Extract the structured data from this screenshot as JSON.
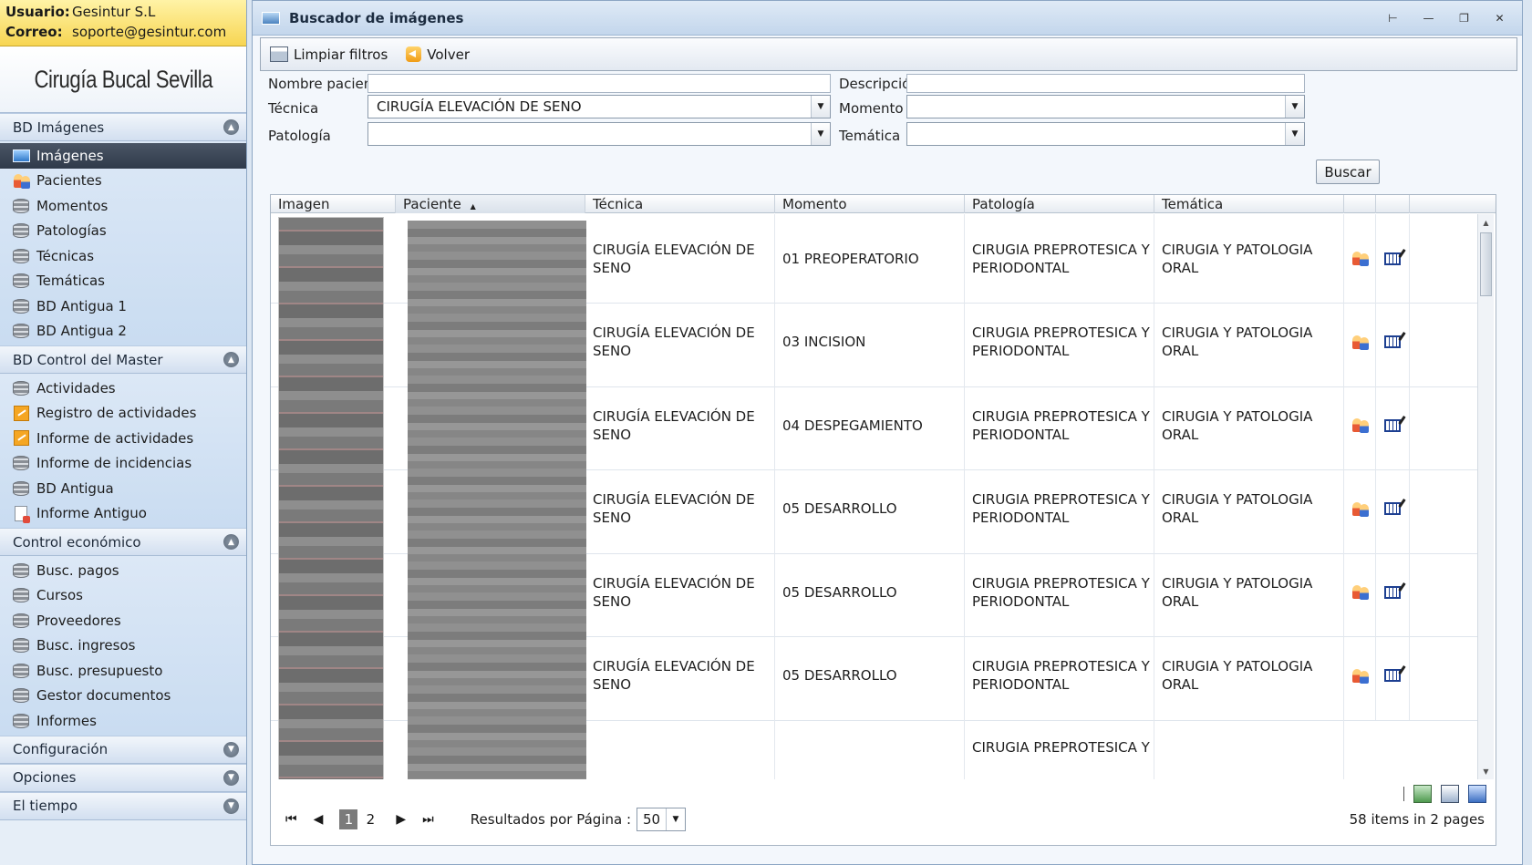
{
  "user": {
    "user_label": "Usuario:",
    "user_value": "Gesintur S.L",
    "mail_label": "Correo:",
    "mail_value": "soporte@gesintur.com"
  },
  "brand": "Cirugía Bucal Sevilla",
  "sections": [
    {
      "title": "BD Imágenes",
      "items": [
        "Imágenes",
        "Pacientes",
        "Momentos",
        "Patologías",
        "Técnicas",
        "Temáticas",
        "BD Antigua 1",
        "BD Antigua 2"
      ]
    },
    {
      "title": "BD Control del Master",
      "items": [
        "Actividades",
        "Registro de actividades",
        "Informe de actividades",
        "Informe de incidencias",
        "BD Antigua",
        "Informe Antiguo"
      ]
    },
    {
      "title": "Control económico",
      "items": [
        "Busc. pagos",
        "Cursos",
        "Proveedores",
        "Busc. ingresos",
        "Busc. presupuesto",
        "Gestor documentos",
        "Informes"
      ]
    },
    {
      "title": "Configuración"
    },
    {
      "title": "Opciones"
    },
    {
      "title": "El tiempo"
    }
  ],
  "window": {
    "title": "Buscador de imágenes"
  },
  "toolbar": {
    "clear_label": "Limpiar filtros",
    "back_label": "Volver"
  },
  "filters": {
    "patient_label": "Nombre paciente",
    "patient_value": "",
    "desc_label": "Descripción",
    "desc_value": "",
    "technique_label": "Técnica",
    "technique_value": "CIRUGÍA ELEVACIÓN DE SENO",
    "moment_label": "Momento",
    "moment_value": "",
    "pathology_label": "Patología",
    "pathology_value": "",
    "theme_label": "Temática",
    "theme_value": "",
    "search_label": "Buscar"
  },
  "grid": {
    "columns": [
      "Imagen",
      "Paciente",
      "Técnica",
      "Momento",
      "Patología",
      "Temática"
    ],
    "rows": [
      {
        "tecnica": "CIRUGÍA ELEVACIÓN DE SENO",
        "momento": "01 PREOPERATORIO",
        "patologia": "CIRUGIA PREPROTESICA Y PERIODONTAL",
        "tematica": "CIRUGIA Y PATOLOGIA ORAL"
      },
      {
        "tecnica": "CIRUGÍA ELEVACIÓN DE SENO",
        "momento": "03 INCISION",
        "patologia": "CIRUGIA PREPROTESICA Y PERIODONTAL",
        "tematica": "CIRUGIA Y PATOLOGIA ORAL"
      },
      {
        "tecnica": "CIRUGÍA ELEVACIÓN DE SENO",
        "momento": "04 DESPEGAMIENTO",
        "patologia": "CIRUGIA PREPROTESICA Y PERIODONTAL",
        "tematica": "CIRUGIA Y PATOLOGIA ORAL"
      },
      {
        "tecnica": "CIRUGÍA ELEVACIÓN DE SENO",
        "momento": "05 DESARROLLO",
        "patologia": "CIRUGIA PREPROTESICA Y PERIODONTAL",
        "tematica": "CIRUGIA Y PATOLOGIA ORAL"
      },
      {
        "tecnica": "CIRUGÍA ELEVACIÓN DE SENO",
        "momento": "05 DESARROLLO",
        "patologia": "CIRUGIA PREPROTESICA Y PERIODONTAL",
        "tematica": "CIRUGIA Y PATOLOGIA ORAL"
      },
      {
        "tecnica": "CIRUGÍA ELEVACIÓN DE SENO",
        "momento": "05 DESARROLLO",
        "patologia": "CIRUGIA PREPROTESICA Y PERIODONTAL",
        "tematica": "CIRUGIA Y PATOLOGIA ORAL"
      },
      {
        "tecnica": "",
        "momento": "",
        "patologia": "CIRUGIA PREPROTESICA Y",
        "tematica": ""
      }
    ]
  },
  "pager": {
    "pages": [
      "1",
      "2"
    ],
    "current": "1",
    "per_page_label": "Resultados por Página :",
    "per_page_value": "50",
    "info": "58 items in 2 pages"
  }
}
